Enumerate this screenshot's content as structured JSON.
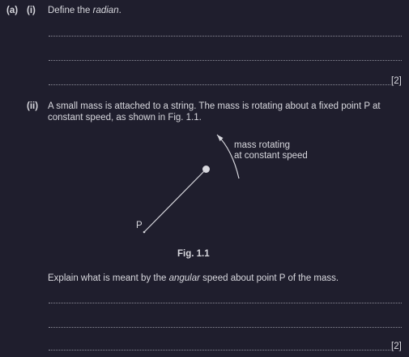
{
  "part_a": {
    "label": "(a)",
    "sub_i": {
      "label": "(i)",
      "prompt_pre": "Define the ",
      "prompt_em": "radian",
      "prompt_post": ".",
      "marks": "[2]"
    },
    "sub_ii": {
      "label": "(ii)",
      "line1": "A small mass is attached to a string. The mass is rotating about a fixed point P at",
      "line2": "constant speed, as shown in Fig. 1.1.",
      "figure": {
        "annotation_line1": "mass rotating",
        "annotation_line2": "at constant speed",
        "point_label": "P",
        "caption": "Fig. 1.1"
      },
      "question_pre": "Explain what is meant by the ",
      "question_em": "angular",
      "question_post": " speed about point P of the mass.",
      "marks": "[2]"
    }
  }
}
